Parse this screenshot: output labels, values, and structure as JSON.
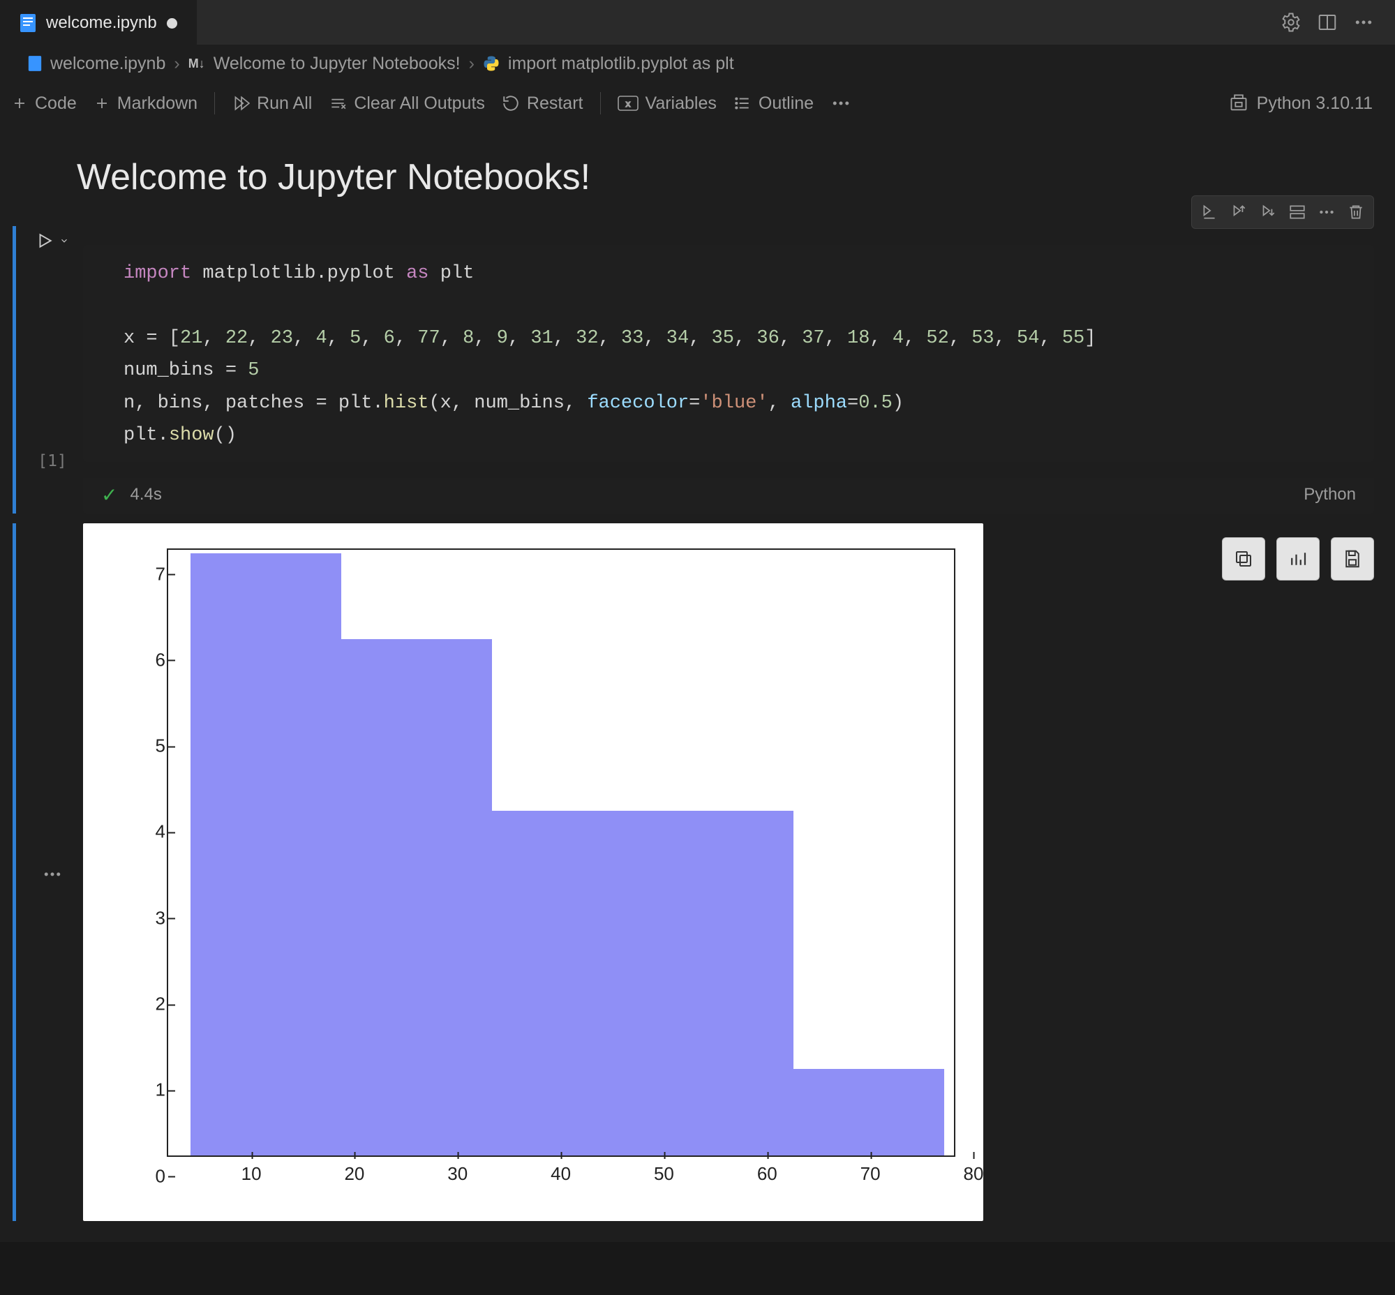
{
  "tab": {
    "filename": "welcome.ipynb",
    "dirty": true
  },
  "breadcrumbs": {
    "file": "welcome.ipynb",
    "section": "Welcome to Jupyter Notebooks!",
    "leaf": "import matplotlib.pyplot as plt"
  },
  "toolbar": {
    "add_code": "Code",
    "add_markdown": "Markdown",
    "run_all": "Run All",
    "clear_outputs": "Clear All Outputs",
    "restart": "Restart",
    "variables": "Variables",
    "outline": "Outline",
    "more": "…",
    "kernel": "Python 3.10.11"
  },
  "markdown_cell": {
    "title": "Welcome to Jupyter Notebooks!"
  },
  "code_cell": {
    "execution_count": "[1]",
    "duration": "4.4s",
    "language": "Python",
    "code_lines": [
      {
        "t": "import ",
        "c": "kw"
      },
      {
        "t": "matplotlib.pyplot ",
        "c": "id"
      },
      {
        "t": "as ",
        "c": "kw"
      },
      {
        "t": "plt",
        "c": "id"
      },
      {
        "t": "\n\n",
        "c": ""
      },
      {
        "t": "x = [",
        "c": "id"
      },
      {
        "t": "21",
        "c": "num"
      },
      {
        "t": ", ",
        "c": "id"
      },
      {
        "t": "22",
        "c": "num"
      },
      {
        "t": ", ",
        "c": "id"
      },
      {
        "t": "23",
        "c": "num"
      },
      {
        "t": ", ",
        "c": "id"
      },
      {
        "t": "4",
        "c": "num"
      },
      {
        "t": ", ",
        "c": "id"
      },
      {
        "t": "5",
        "c": "num"
      },
      {
        "t": ", ",
        "c": "id"
      },
      {
        "t": "6",
        "c": "num"
      },
      {
        "t": ", ",
        "c": "id"
      },
      {
        "t": "77",
        "c": "num"
      },
      {
        "t": ", ",
        "c": "id"
      },
      {
        "t": "8",
        "c": "num"
      },
      {
        "t": ", ",
        "c": "id"
      },
      {
        "t": "9",
        "c": "num"
      },
      {
        "t": ", ",
        "c": "id"
      },
      {
        "t": "31",
        "c": "num"
      },
      {
        "t": ", ",
        "c": "id"
      },
      {
        "t": "32",
        "c": "num"
      },
      {
        "t": ", ",
        "c": "id"
      },
      {
        "t": "33",
        "c": "num"
      },
      {
        "t": ", ",
        "c": "id"
      },
      {
        "t": "34",
        "c": "num"
      },
      {
        "t": ", ",
        "c": "id"
      },
      {
        "t": "35",
        "c": "num"
      },
      {
        "t": ", ",
        "c": "id"
      },
      {
        "t": "36",
        "c": "num"
      },
      {
        "t": ", ",
        "c": "id"
      },
      {
        "t": "37",
        "c": "num"
      },
      {
        "t": ", ",
        "c": "id"
      },
      {
        "t": "18",
        "c": "num"
      },
      {
        "t": ", ",
        "c": "id"
      },
      {
        "t": "4",
        "c": "num"
      },
      {
        "t": ", ",
        "c": "id"
      },
      {
        "t": "52",
        "c": "num"
      },
      {
        "t": ", ",
        "c": "id"
      },
      {
        "t": "53",
        "c": "num"
      },
      {
        "t": ", ",
        "c": "id"
      },
      {
        "t": "54",
        "c": "num"
      },
      {
        "t": ", ",
        "c": "id"
      },
      {
        "t": "55",
        "c": "num"
      },
      {
        "t": "]\n",
        "c": "id"
      },
      {
        "t": "num_bins = ",
        "c": "id"
      },
      {
        "t": "5",
        "c": "num"
      },
      {
        "t": "\n",
        "c": ""
      },
      {
        "t": "n, bins, patches = plt.",
        "c": "id"
      },
      {
        "t": "hist",
        "c": "call"
      },
      {
        "t": "(x, num_bins, ",
        "c": "id"
      },
      {
        "t": "facecolor",
        "c": "param"
      },
      {
        "t": "=",
        "c": "id"
      },
      {
        "t": "'blue'",
        "c": "str"
      },
      {
        "t": ", ",
        "c": "id"
      },
      {
        "t": "alpha",
        "c": "param"
      },
      {
        "t": "=",
        "c": "id"
      },
      {
        "t": "0.5",
        "c": "num"
      },
      {
        "t": ")\n",
        "c": "id"
      },
      {
        "t": "plt.",
        "c": "id"
      },
      {
        "t": "show",
        "c": "call"
      },
      {
        "t": "()",
        "c": "id"
      }
    ]
  },
  "chart_data": {
    "type": "bar",
    "title": "",
    "xlabel": "",
    "ylabel": "",
    "x_ticks": [
      10,
      20,
      30,
      40,
      50,
      60,
      70,
      80
    ],
    "y_ticks": [
      0,
      1,
      2,
      3,
      4,
      5,
      6,
      7
    ],
    "xlim": [
      4,
      77
    ],
    "ylim": [
      0,
      7.3
    ],
    "bin_edges": [
      4.0,
      18.6,
      33.2,
      47.8,
      62.4,
      77.0
    ],
    "values": [
      7,
      6,
      4,
      4,
      1
    ],
    "facecolor": "#7f7ff5",
    "alpha": 0.5
  }
}
